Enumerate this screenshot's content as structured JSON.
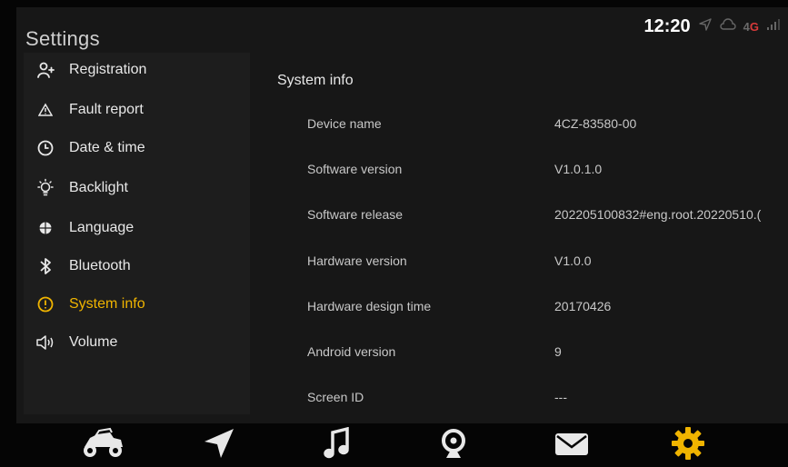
{
  "status": {
    "time": "12:20",
    "network_prefix": "4",
    "network_suffix": "G",
    "icons": [
      "location-arrow-icon",
      "cloud-icon",
      "signal-bars-icon"
    ]
  },
  "app": {
    "title": "Settings"
  },
  "sidebar": {
    "items": [
      {
        "label": "Registration",
        "icon": "person-add-icon"
      },
      {
        "label": "Fault report",
        "icon": "warning-icon"
      },
      {
        "label": "Date & time",
        "icon": "clock-icon"
      },
      {
        "label": "Backlight",
        "icon": "lightbulb-icon"
      },
      {
        "label": "Language",
        "icon": "globe-icon"
      },
      {
        "label": "Bluetooth",
        "icon": "bluetooth-icon"
      },
      {
        "label": "System info",
        "icon": "info-circle-icon",
        "active": true
      },
      {
        "label": "Volume",
        "icon": "speaker-icon"
      }
    ]
  },
  "main": {
    "title": "System info",
    "rows": [
      {
        "label": "Device name",
        "value": "4CZ-83580-00"
      },
      {
        "label": "Software version",
        "value": "V1.0.1.0"
      },
      {
        "label": "Software release",
        "value": "202205100832#eng.root.20220510.("
      },
      {
        "label": "Hardware version",
        "value": "V1.0.0"
      },
      {
        "label": "Hardware design time",
        "value": "20170426"
      },
      {
        "label": "Android version",
        "value": "9"
      },
      {
        "label": "Screen ID",
        "value": "---"
      }
    ]
  },
  "dock": {
    "items": [
      "utv-vehicle-icon",
      "navigation-arrow-icon",
      "music-note-icon",
      "webcam-icon",
      "mail-icon",
      "gear-icon"
    ],
    "active_color": "#f0b400"
  },
  "colors": {
    "accent": "#f0b400",
    "alert": "#d83a3a"
  }
}
